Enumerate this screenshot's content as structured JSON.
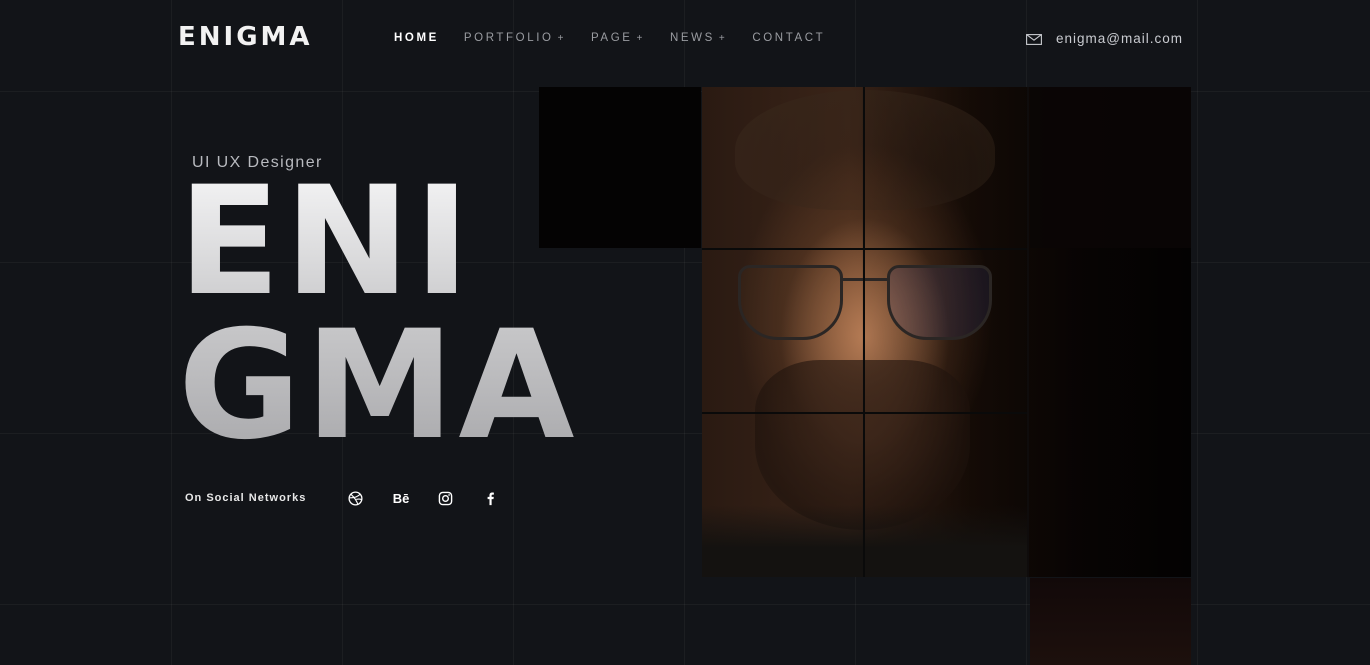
{
  "header": {
    "logo": "ENIGMA",
    "nav": [
      {
        "label": "HOME",
        "active": true,
        "has_submenu": false
      },
      {
        "label": "PORTFOLIO",
        "active": false,
        "has_submenu": true
      },
      {
        "label": "PAGE",
        "active": false,
        "has_submenu": true
      },
      {
        "label": "NEWS",
        "active": false,
        "has_submenu": true
      },
      {
        "label": "CONTACT",
        "active": false,
        "has_submenu": false
      }
    ],
    "submenu_marker": "+",
    "email": "enigma@mail.com"
  },
  "hero": {
    "role": "UI UX Designer",
    "line1": "ENI",
    "line2": "GMA"
  },
  "social": {
    "label": "On Social Networks",
    "behance_text": "Bē",
    "icons": [
      "dribbble-icon",
      "behance-icon",
      "instagram-icon",
      "facebook-icon"
    ]
  },
  "colors": {
    "background": "#121418",
    "text": "#e6e6e6",
    "nav_inactive": "#9a9ca1"
  }
}
